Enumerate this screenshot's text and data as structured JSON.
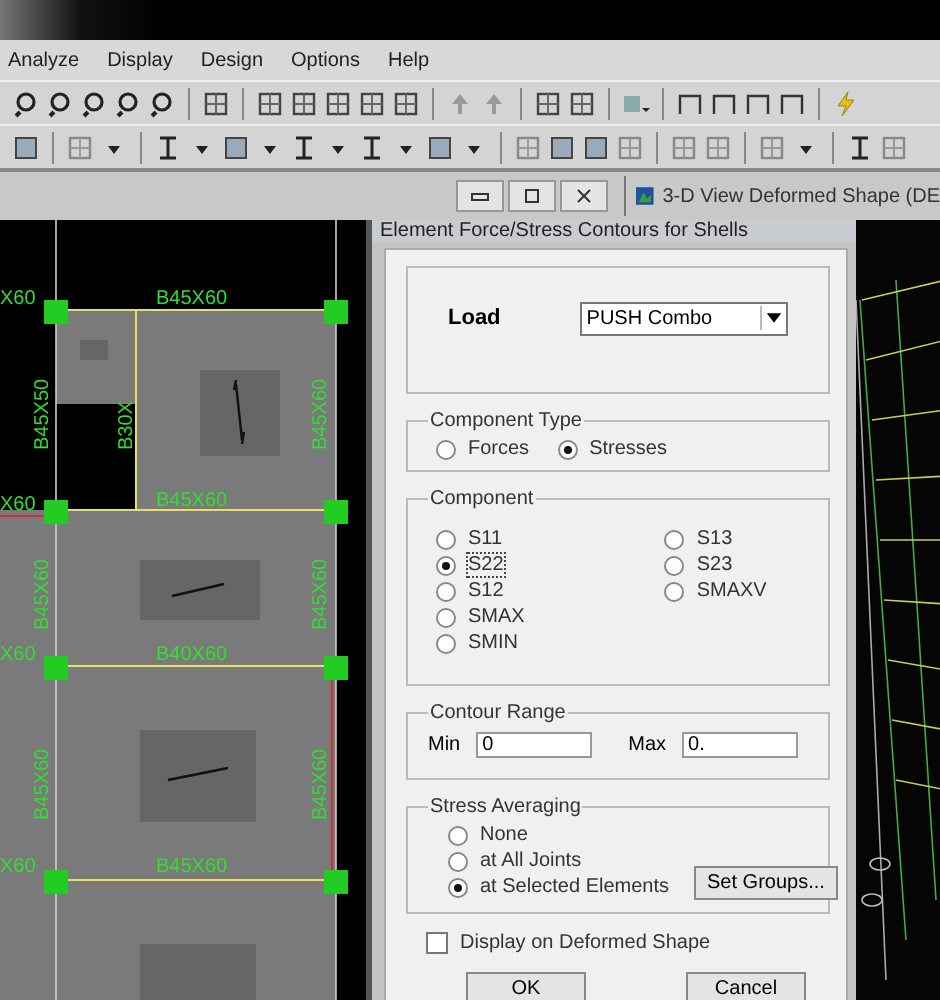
{
  "menu": [
    {
      "label": "Analyze"
    },
    {
      "label": "Display"
    },
    {
      "label": "Design"
    },
    {
      "label": "Options"
    },
    {
      "label": "Help"
    }
  ],
  "view_window": {
    "title": "3-D View  Deformed Shape (DE"
  },
  "plan": {
    "labels": [
      {
        "text": "X60",
        "kind": "horizontal"
      },
      {
        "text": "B45X60",
        "kind": "horizontal"
      },
      {
        "text": "B45X50",
        "kind": "vertical"
      },
      {
        "text": "B30X",
        "kind": "vertical"
      },
      {
        "text": "B45X60",
        "kind": "vertical"
      },
      {
        "text": "X60",
        "kind": "horizontal"
      },
      {
        "text": "B45X60",
        "kind": "horizontal"
      },
      {
        "text": "B45X60",
        "kind": "vertical"
      },
      {
        "text": "B45X60",
        "kind": "vertical"
      },
      {
        "text": "X60",
        "kind": "horizontal"
      },
      {
        "text": "B40X60",
        "kind": "horizontal"
      },
      {
        "text": "B45X60",
        "kind": "vertical"
      },
      {
        "text": "B45X60",
        "kind": "vertical"
      },
      {
        "text": "X60",
        "kind": "horizontal"
      },
      {
        "text": "B45X60",
        "kind": "horizontal"
      }
    ]
  },
  "dialog": {
    "title": "Element Force/Stress Contours for Shells",
    "load": {
      "label": "Load",
      "value": "PUSH Combo"
    },
    "component_type": {
      "title": "Component Type",
      "options": [
        {
          "label": "Forces",
          "selected": false
        },
        {
          "label": "Stresses",
          "selected": true
        }
      ]
    },
    "component": {
      "title": "Component",
      "columns": [
        [
          {
            "label": "S11",
            "selected": false
          },
          {
            "label": "S22",
            "selected": true
          },
          {
            "label": "S12",
            "selected": false
          },
          {
            "label": "SMAX",
            "selected": false
          },
          {
            "label": "SMIN",
            "selected": false
          }
        ],
        [
          {
            "label": "S13",
            "selected": false
          },
          {
            "label": "S23",
            "selected": false
          },
          {
            "label": "SMAXV",
            "selected": false
          }
        ]
      ]
    },
    "contour_range": {
      "title": "Contour Range",
      "min_label": "Min",
      "min_value": "0",
      "max_label": "Max",
      "max_value": "0."
    },
    "stress_averaging": {
      "title": "Stress Averaging",
      "options": [
        {
          "label": "None",
          "selected": false
        },
        {
          "label": "at All Joints",
          "selected": false
        },
        {
          "label": "at Selected Elements",
          "selected": true
        }
      ],
      "button": "Set Groups..."
    },
    "deformed_checkbox": {
      "label": "Display on Deformed Shape",
      "checked": false
    },
    "buttons": [
      "OK",
      "Cancel"
    ]
  }
}
